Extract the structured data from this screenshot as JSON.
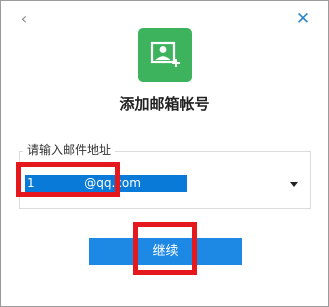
{
  "header": {
    "back_icon": "chevron-left-icon",
    "back_glyph": "‹",
    "close_icon": "close-icon",
    "close_glyph": "✕"
  },
  "logo": {
    "icon": "add-mailbox-icon",
    "color": "#3db35d"
  },
  "title": "添加邮箱帐号",
  "email_field": {
    "label": "请输入邮件地址",
    "value": "1             @qq.com",
    "dropdown_icon": "dropdown-arrow-icon"
  },
  "continue_button": {
    "label": "继续",
    "color": "#1e88e5"
  },
  "highlight_color": "#e5191d"
}
